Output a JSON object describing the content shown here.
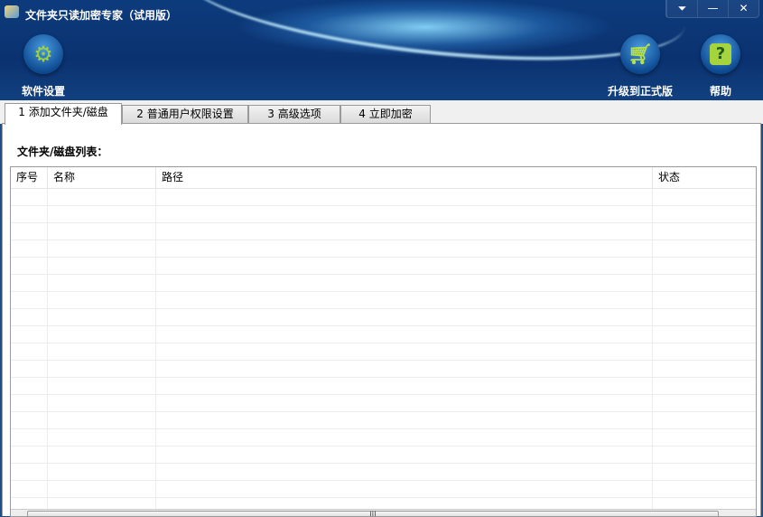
{
  "window": {
    "title": "文件夹只读加密专家（试用版）",
    "controls": [
      "⏷",
      "—",
      "✕"
    ]
  },
  "toolbar": {
    "settings": "软件设置",
    "upgrade": "升级到正式版",
    "help": "帮助"
  },
  "tabs": [
    "1 添加文件夹/磁盘",
    "2 普通用户权限设置",
    "3 高级选项",
    "4 立即加密"
  ],
  "panel": {
    "list_label": "文件夹/磁盘列表：",
    "columns": [
      "序号",
      "名称",
      "路径",
      "状态"
    ]
  }
}
